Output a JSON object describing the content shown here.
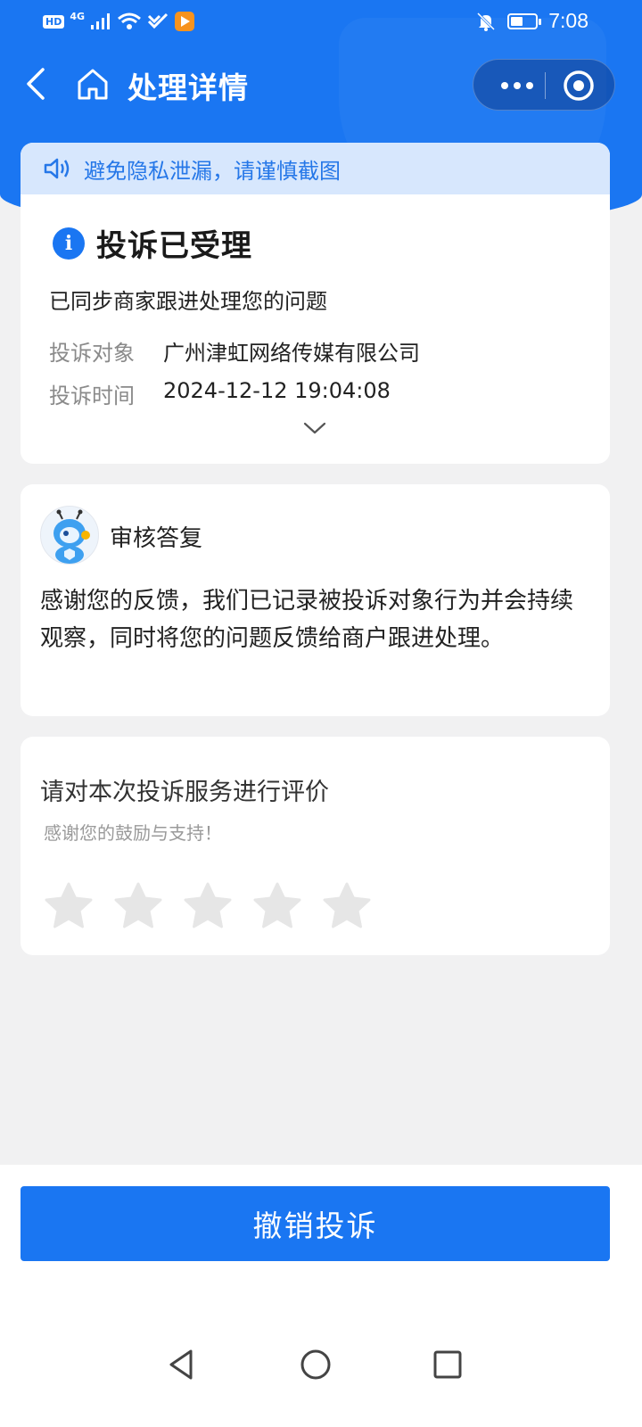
{
  "status_bar": {
    "hd": "HD",
    "network": "4G",
    "time": "7:08"
  },
  "nav": {
    "title": "处理详情",
    "icons": [
      "back-icon",
      "home-icon",
      "more-icon",
      "target-icon"
    ]
  },
  "notice": {
    "text": "避免隐私泄漏，请谨慎截图",
    "icon": "speaker-icon"
  },
  "complaint": {
    "status_title": "投诉已受理",
    "status_desc": "已同步商家跟进处理您的问题",
    "target_label": "投诉对象",
    "target_value": "广州津虹网络传媒有限公司",
    "time_label": "投诉时间",
    "time_value": "2024-12-12 19:04:08"
  },
  "reply": {
    "title": "审核答复",
    "text": "感谢您的反馈，我们已记录被投诉对象行为并会持续观察，同时将您的问题反馈给商户跟进处理。"
  },
  "rating": {
    "title": "请对本次投诉服务进行评价",
    "subtitle": "感谢您的鼓励与支持！",
    "stars_total": 5,
    "stars_selected": 0
  },
  "actions": {
    "cancel_label": "撤销投诉"
  },
  "colors": {
    "primary": "#1a76f2",
    "notice_bg": "#d7e7fd",
    "star_empty": "#e6e6e6"
  }
}
